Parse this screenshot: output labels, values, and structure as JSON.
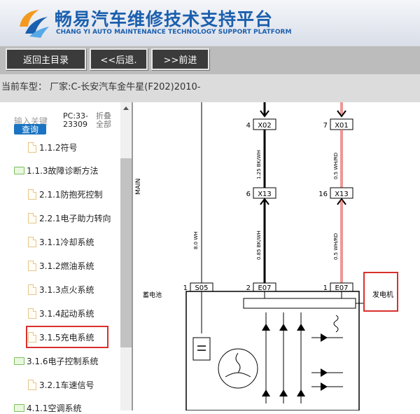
{
  "header": {
    "title_cn": "畅易汽车维修技术支持平台",
    "title_en": "CHANG YI AUTO MAINTENANCE TECHNOLOGY SUPPORT PLATFORM"
  },
  "nav": {
    "home": "返回主目录",
    "back": "<<后退.",
    "forward": ">>前进"
  },
  "info": {
    "current_vehicle": "当前车型： 厂家:C-长安汽车金牛星(F202)2010-"
  },
  "sidebar": {
    "search_label": "输入关键",
    "search_button": "查询",
    "pc_line1": "PC:33-",
    "pc_line2": "23309",
    "fold_line1": "折叠",
    "fold_line2": "全部",
    "items": [
      {
        "label": "1.1.2符号",
        "type": "file"
      },
      {
        "label": "1.1.3故障诊断方法",
        "type": "folder"
      },
      {
        "label": "2.1.1防抱死控制",
        "type": "file"
      },
      {
        "label": "2.2.1电子助力转向",
        "type": "file"
      },
      {
        "label": "3.1.1冷却系统",
        "type": "file"
      },
      {
        "label": "3.1.2燃油系统",
        "type": "file"
      },
      {
        "label": "3.1.3点火系统",
        "type": "file"
      },
      {
        "label": "3.1.4起动系统",
        "type": "file"
      },
      {
        "label": "3.1.5充电系统",
        "type": "file",
        "highlighted": true
      },
      {
        "label": "3.1.6电子控制系统",
        "type": "folder"
      },
      {
        "label": "3.2.1车速信号",
        "type": "file"
      },
      {
        "label": "4.1.1空调系统",
        "type": "folder"
      }
    ]
  },
  "diagram": {
    "main_label": "MAIN",
    "connectors": {
      "x02": "X02",
      "x01": "X01",
      "x13a": "X13",
      "x13b": "X13",
      "s05": "S05",
      "e07a": "E07",
      "e07b": "E07"
    },
    "pins": {
      "p4": "4",
      "p7": "7",
      "p6": "6",
      "p16": "16",
      "p1a": "1",
      "p2": "2",
      "p1b": "1"
    },
    "wires": {
      "w1": "1.25 BK/WH",
      "w2": "0.5 WH/RD",
      "w3": "0.85 BK/WH",
      "w4": "0.5 WH/RD",
      "w5": "8.0 WH"
    },
    "battery_label": "蓄电池",
    "generator_label": "发电机"
  },
  "colors": {
    "brand_blue": "#1b5fae",
    "highlight_red": "#d9302c",
    "button_dark": "#3b3b3b",
    "search_blue": "#1a74c2"
  }
}
